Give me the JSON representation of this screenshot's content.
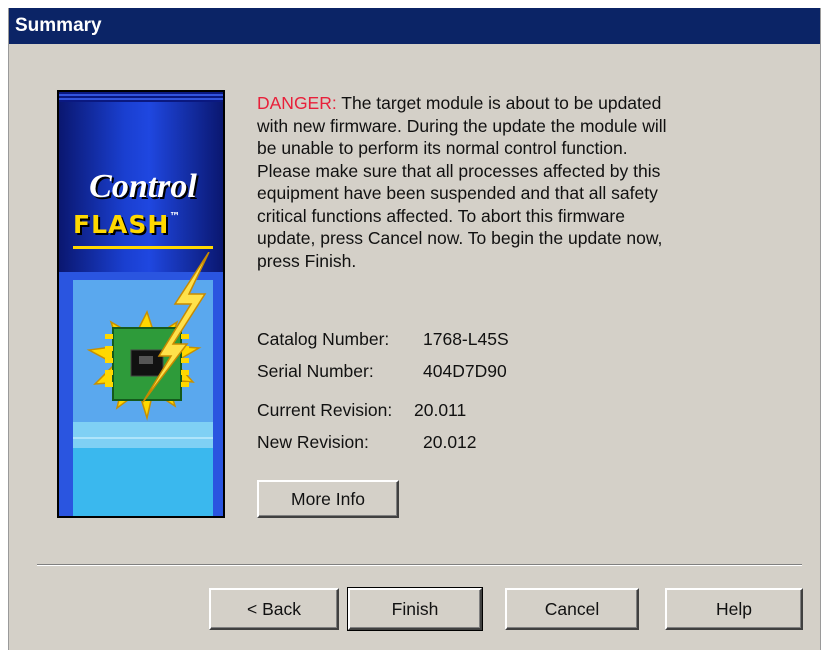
{
  "window": {
    "title": "Summary"
  },
  "banner": {
    "line1": "Control",
    "line2": "FLASH",
    "trademark": "™"
  },
  "message": {
    "danger_label": "DANGER:",
    "body": " The target module is about to be updated with new firmware. During the update the module will be unable to perform its normal control function. Please make sure that all processes affected by this equipment have been suspended and that all safety critical functions affected. To abort this firmware update, press Cancel now. To begin the update now, press Finish."
  },
  "details": {
    "catalog": {
      "label": "Catalog Number:",
      "value": "1768-L45S"
    },
    "serial": {
      "label": "Serial Number:",
      "value": "404D7D90"
    },
    "current_revision": {
      "label": "Current Revision:",
      "value": "20.011"
    },
    "new_revision": {
      "label": "New Revision:",
      "value": "20.012"
    }
  },
  "buttons": {
    "more_info": "More Info",
    "back": "< Back",
    "finish": "Finish",
    "cancel": "Cancel",
    "help": "Help"
  },
  "colors": {
    "titlebar": "#0b2466",
    "danger": "#e8203a",
    "dialog_bg": "#d4d0c8",
    "flash_yellow": "#ffd800"
  }
}
